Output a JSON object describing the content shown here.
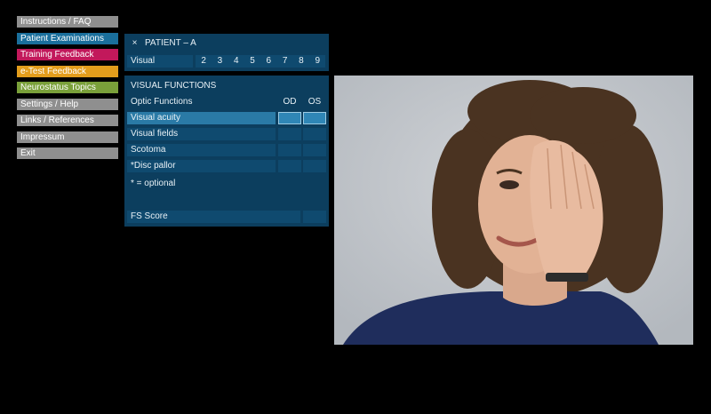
{
  "menu": {
    "items": [
      {
        "label": "Instructions / FAQ",
        "color": "#8f8f8f"
      },
      {
        "label": "Patient Examinations",
        "color": "#1a6f9c"
      },
      {
        "label": "Training Feedback",
        "color": "#c2185b"
      },
      {
        "label": "e-Test Feedback",
        "color": "#e39d1c"
      },
      {
        "label": "Neurostatus Topics",
        "color": "#7aa03a"
      },
      {
        "label": "Settings / Help",
        "color": "#8f8f8f"
      },
      {
        "label": "Links / References",
        "color": "#8f8f8f"
      },
      {
        "label": "Impressum",
        "color": "#8f8f8f"
      },
      {
        "label": "Exit",
        "color": "#8f8f8f"
      }
    ]
  },
  "patient": {
    "close_icon": "×",
    "title": "PATIENT – A",
    "visual_label": "Visual",
    "tabs": [
      "2",
      "3",
      "4",
      "5",
      "6",
      "7",
      "8",
      "9"
    ]
  },
  "visual_functions": {
    "header": "VISUAL FUNCTIONS",
    "optic_label": "Optic Functions",
    "od": "OD",
    "os": "OS",
    "rows": [
      "Visual acuity",
      "Visual fields",
      "Scotoma",
      "*Disc pallor"
    ],
    "optional_note": "* = optional",
    "fs_score": "FS Score"
  }
}
